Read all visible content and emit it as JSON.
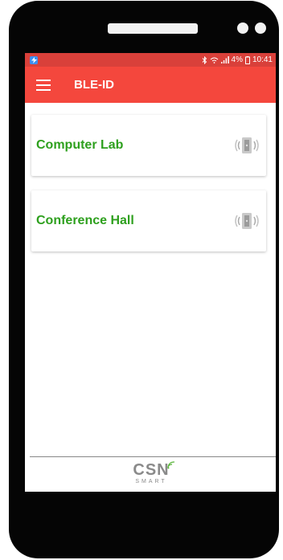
{
  "status_bar": {
    "bluetooth_icon": "bluetooth-icon",
    "signal_icon": "signal-icon",
    "battery_percent": "4%",
    "time": "10:41"
  },
  "app_bar": {
    "menu_icon": "hamburger-menu-icon",
    "title": "BLE-ID"
  },
  "rooms": [
    {
      "label": "Computer Lab",
      "icon": "beacon-icon"
    },
    {
      "label": "Conference Hall",
      "icon": "beacon-icon"
    }
  ],
  "footer": {
    "logo_main": "CSN",
    "logo_sub": "SMART"
  },
  "colors": {
    "status_bar": "#d9403a",
    "app_bar": "#f4473d",
    "room_title": "#2ea01e"
  }
}
